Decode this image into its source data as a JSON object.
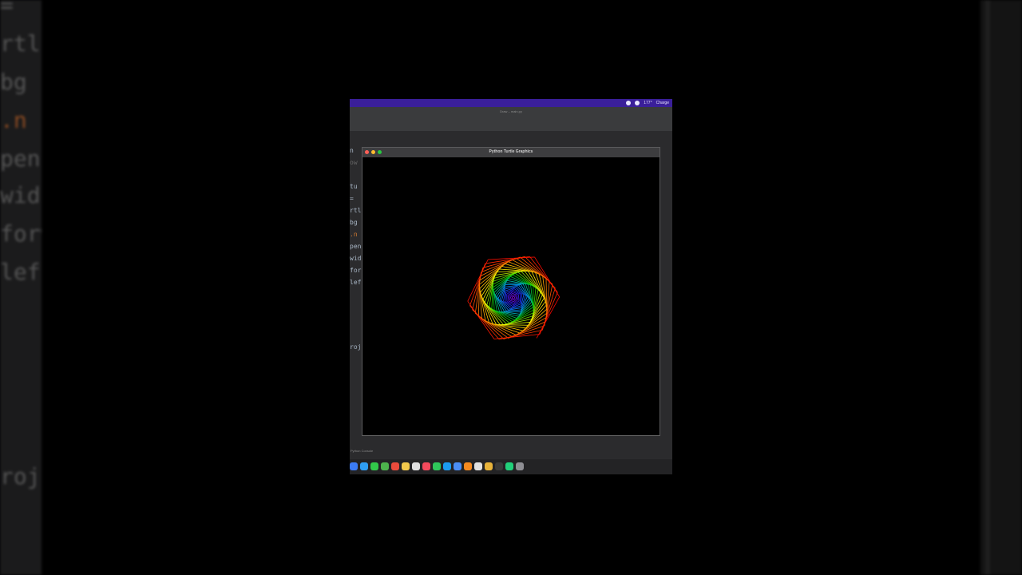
{
  "background": {
    "code_fragments": [
      "=",
      "rtle",
      "bg",
      ".n",
      "pend",
      "wid",
      "forw",
      "left",
      "roje"
    ]
  },
  "menubar": {
    "tray_items": [
      "177°",
      "Charge"
    ]
  },
  "ide": {
    "file_title": "Draw – main.py",
    "code_fragments": [
      "n",
      "ow",
      "tu",
      "=",
      "rtle",
      "bg",
      ".n",
      "pend",
      "wid",
      "for",
      "left",
      "roje"
    ],
    "console_label": "Python Console"
  },
  "turtle_window": {
    "title": "Python Turtle Graphics",
    "drawing": {
      "background": "#000000",
      "shape": "hexagon",
      "sides": 6,
      "turn_angle_deg": 61,
      "palette": [
        "#ff0000",
        "#ff8800",
        "#ffff00",
        "#00cc00",
        "#00aaff",
        "#2222ff",
        "#aa00ff"
      ]
    }
  },
  "dock": {
    "apps": [
      "finder",
      "safari",
      "messages",
      "maps",
      "photos",
      "notes",
      "calendar",
      "music",
      "facetime",
      "app-store",
      "xcode",
      "vlc",
      "preview",
      "chrome",
      "terminal",
      "pycharm",
      "settings"
    ],
    "colors": [
      "#3b7bf5",
      "#2f9ef4",
      "#32c94a",
      "#4db34d",
      "#e94b3c",
      "#f2c94c",
      "#e0e0e0",
      "#f34a5c",
      "#2fc75a",
      "#1c9bf0",
      "#4b8ef5",
      "#f58a1f",
      "#e0e0e0",
      "#e8b33a",
      "#3a3a3a",
      "#21d07a",
      "#8e8e93"
    ]
  }
}
